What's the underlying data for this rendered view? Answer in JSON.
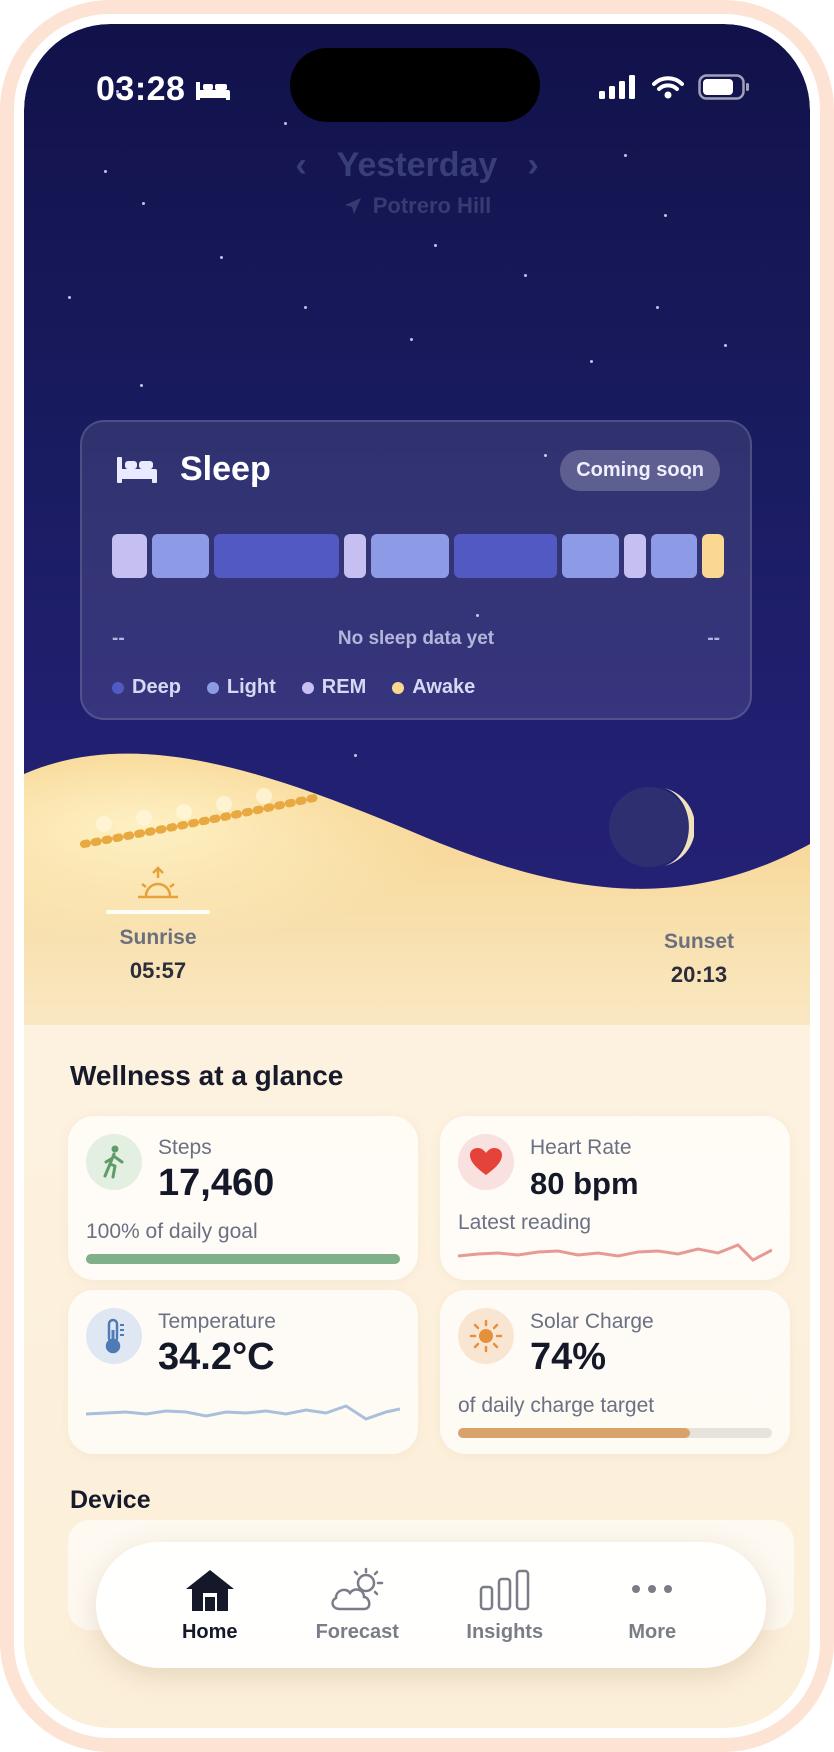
{
  "status": {
    "time": "03:28"
  },
  "header": {
    "title": "Yesterday",
    "location": "Potrero Hill"
  },
  "sleep": {
    "title": "Sleep",
    "badge": "Coming soon",
    "message": "No sleep data yet",
    "start": "--",
    "end": "--",
    "legend": [
      "Deep",
      "Light",
      "REM",
      "Awake"
    ],
    "colors": {
      "deep": "#5259c2",
      "light": "#8d9be6",
      "rem": "#c6c0f2",
      "awake": "#fbd891"
    }
  },
  "sun": {
    "sunrise_label": "Sunrise",
    "sunrise_time": "05:57",
    "sunset_label": "Sunset",
    "sunset_time": "20:13"
  },
  "wellness": {
    "title": "Wellness at a glance",
    "steps": {
      "label": "Steps",
      "value": "17,460",
      "sub": "100% of daily goal",
      "progress": 1.0,
      "color": "#7fb08a"
    },
    "heart": {
      "label": "Heart Rate",
      "value": "80 bpm",
      "sub": "Latest reading",
      "color": "#e79a95"
    },
    "temperature": {
      "label": "Temperature",
      "value": "34.2°C",
      "color": "#a9bfdc"
    },
    "solar": {
      "label": "Solar Charge",
      "value": "74%",
      "sub": "of daily charge target",
      "progress": 0.74,
      "color": "#d7a36b"
    }
  },
  "device": {
    "title": "Device"
  },
  "tabs": [
    {
      "label": "Home",
      "icon": "home-icon",
      "active": true
    },
    {
      "label": "Forecast",
      "icon": "cloud-sun-icon",
      "active": false
    },
    {
      "label": "Insights",
      "icon": "bars-icon",
      "active": false
    },
    {
      "label": "More",
      "icon": "more-icon",
      "active": false
    }
  ]
}
